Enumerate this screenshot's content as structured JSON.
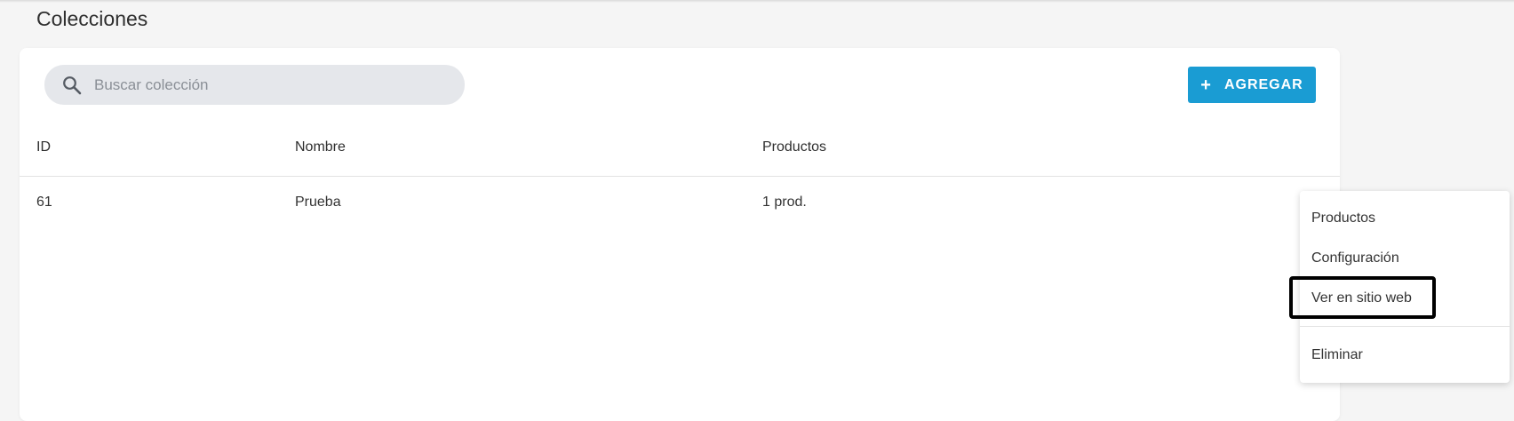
{
  "page": {
    "title": "Colecciones"
  },
  "search": {
    "placeholder": "Buscar colección",
    "icon": "search-icon"
  },
  "toolbar": {
    "add_label": "AGREGAR",
    "add_icon": "+"
  },
  "table": {
    "columns": [
      "ID",
      "Nombre",
      "Productos"
    ],
    "rows": [
      {
        "id": "61",
        "nombre": "Prueba",
        "productos": "1 prod."
      }
    ]
  },
  "context_menu": {
    "items": [
      "Productos",
      "Configuración",
      "Ver en sitio web",
      "Eliminar"
    ],
    "highlighted": "Ver en sitio web"
  },
  "colors": {
    "accent": "#1a9cd3",
    "search_bg": "#e5e7eb",
    "page_bg": "#f5f5f5"
  }
}
